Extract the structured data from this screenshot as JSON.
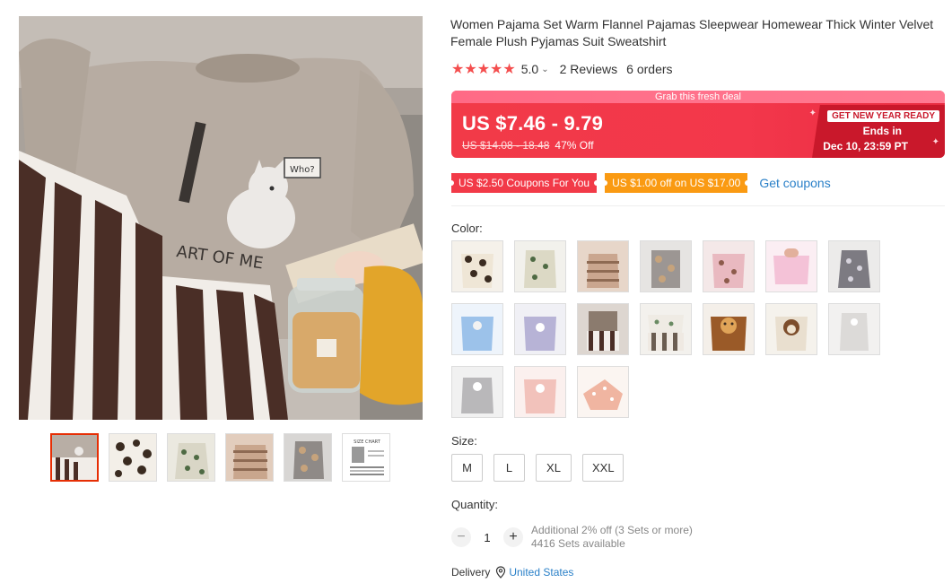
{
  "product": {
    "title": "Women Pajama Set Warm Flannel Pajamas Sleepwear Homewear Thick Winter Velvet Female Plush Pyjamas Suit Sweatshirt",
    "rating": "5.0",
    "reviews": "2 Reviews",
    "orders": "6 orders",
    "star_count": 5
  },
  "deal": {
    "banner_text": "Grab this fresh deal",
    "price": "US $7.46 - 9.79",
    "original_price": "US $14.08 - 18.48",
    "discount": "47% Off",
    "promo_tag": "GET NEW YEAR READY",
    "ends_label": "Ends in",
    "ends_date": "Dec 10, 23:59 PT"
  },
  "coupons": {
    "coupon1": "US $2.50 Coupons For You",
    "coupon2": "US $1.00 off on US $17.00",
    "get_coupons": "Get coupons"
  },
  "color": {
    "label": "Color:",
    "swatch_count": 17
  },
  "size": {
    "label": "Size:",
    "options": [
      "M",
      "L",
      "XL",
      "XXL"
    ]
  },
  "quantity": {
    "label": "Quantity:",
    "value": "1",
    "minus": "−",
    "plus": "+",
    "bulk_offer": "Additional 2% off (3 Sets or more)",
    "stock": "4416 Sets available"
  },
  "delivery": {
    "label": "Delivery",
    "country": "United States"
  },
  "gallery": {
    "main_text": "ART OF ME",
    "bubble_text": "Who?",
    "size_chart_label": "SIZE CHART"
  },
  "colors": {
    "accent": "#f23a48",
    "link": "#2a80c8",
    "coupon_orange": "#fa9a12"
  }
}
